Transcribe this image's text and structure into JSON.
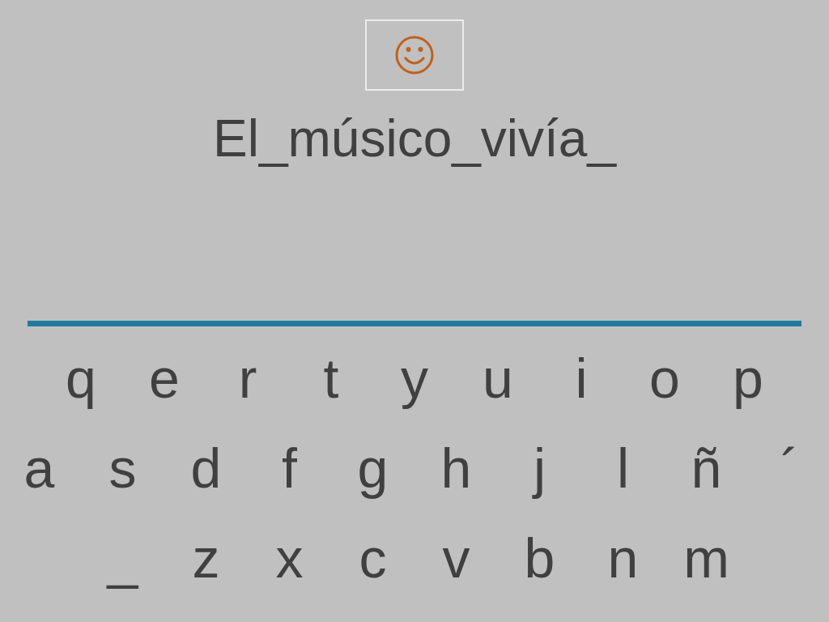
{
  "answer": "El_músico_vivía_",
  "keyboard": {
    "rows": [
      [
        "q",
        "e",
        "r",
        "t",
        "y",
        "u",
        "i",
        "o",
        "p"
      ],
      [
        "a",
        "s",
        "d",
        "f",
        "g",
        "h",
        "j",
        "l",
        "ñ",
        "´"
      ],
      [
        "_",
        "z",
        "x",
        "c",
        "v",
        "b",
        "n",
        "m"
      ]
    ]
  }
}
